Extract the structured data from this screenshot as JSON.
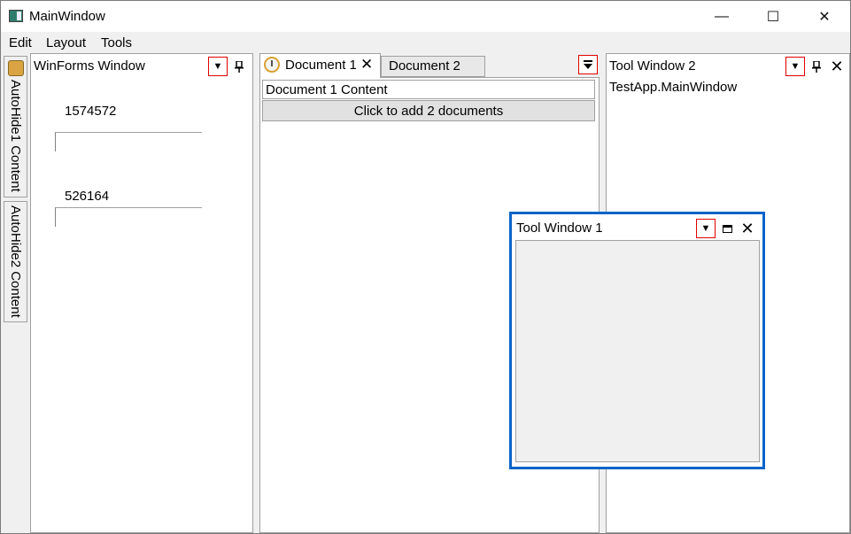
{
  "window": {
    "title": "MainWindow",
    "caption_buttons": [
      "—",
      "☐",
      "✕"
    ]
  },
  "menu": {
    "items": [
      "Edit",
      "Layout",
      "Tools"
    ]
  },
  "autohide": {
    "tabs": [
      {
        "label": "AutoHide1 Content",
        "icon": "autohide-icon"
      },
      {
        "label": "AutoHide2 Content"
      }
    ]
  },
  "winforms_panel": {
    "title": "WinForms Window",
    "dropdown_glyph": "▼",
    "pin_glyph": "📌",
    "values": [
      "1574572",
      "526164"
    ]
  },
  "documents": {
    "tabs": [
      {
        "label": "Document 1",
        "icon": "clock-icon",
        "active": true
      },
      {
        "label": "Document 2",
        "active": false
      }
    ],
    "close_glyph": "✕",
    "list_glyph": "☰",
    "content_label": "Document 1 Content",
    "add_button": "Click to add 2 documents"
  },
  "tool_window_2": {
    "title": "Tool Window 2",
    "text": "TestApp.MainWindow",
    "dropdown_glyph": "▼",
    "pin_glyph": "📌",
    "close_glyph": "✕"
  },
  "tool_window_1": {
    "title": "Tool Window 1",
    "dropdown_glyph": "▼",
    "close_glyph": "✕"
  },
  "colors": {
    "float_border": "#0a64c8",
    "dropdown_highlight": "#e00000"
  }
}
